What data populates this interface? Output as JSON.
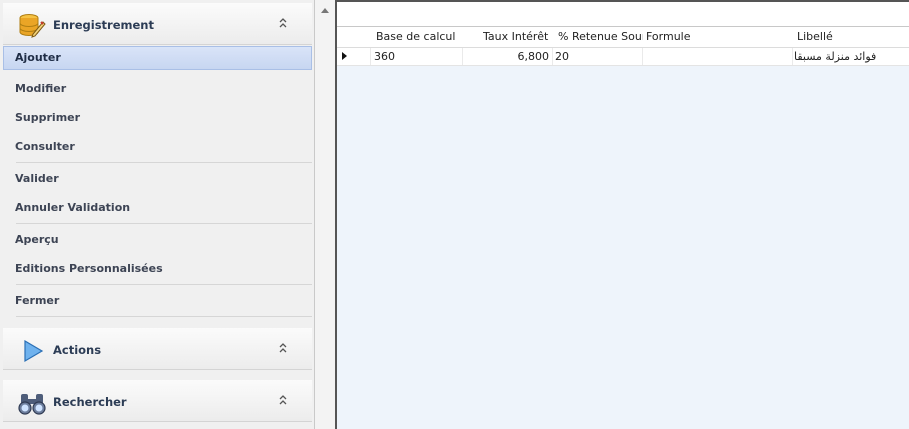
{
  "sidebar": {
    "groups": [
      {
        "title": "Enregistrement",
        "icon": "database-pencil-icon",
        "items": [
          {
            "label": "Ajouter",
            "selected": true
          },
          {
            "label": "Modifier"
          },
          {
            "label": "Supprimer"
          },
          {
            "label": "Consulter"
          },
          {
            "label": "Valider"
          },
          {
            "label": "Annuler Validation"
          },
          {
            "label": "Aperçu"
          },
          {
            "label": "Editions Personnalisées"
          },
          {
            "label": "Fermer"
          }
        ]
      },
      {
        "title": "Actions",
        "icon": "play-arrow-icon"
      },
      {
        "title": "Rechercher",
        "icon": "binoculars-icon"
      }
    ]
  },
  "grid": {
    "columns": [
      "Base de calcul",
      "Taux Intérêt",
      "% Retenue Source",
      "Formule",
      "Libellé"
    ],
    "rows": [
      {
        "base": "360",
        "taux": "6,800",
        "retenue": "20",
        "formule": "",
        "libelle": "فوائد منزلة مسبقا"
      }
    ]
  },
  "colors": {
    "selection": "#c7d6f1",
    "grid_background": "#eef4fb",
    "accent_text": "#2c3c55"
  }
}
